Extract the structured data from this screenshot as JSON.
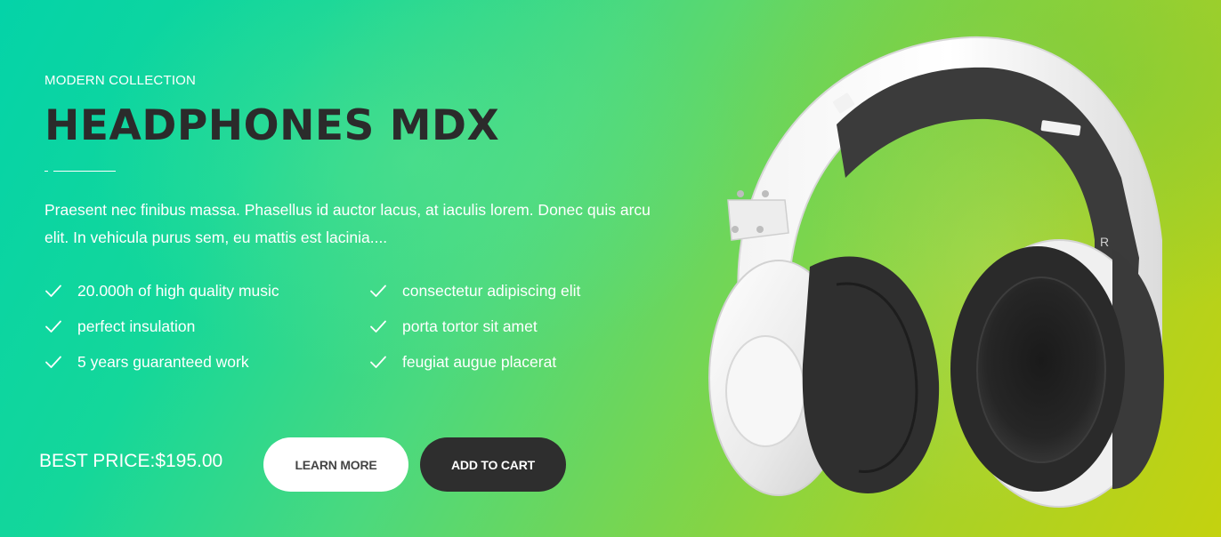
{
  "hero": {
    "eyebrow": "MODERN COLLECTION",
    "title": "HEADPHONES MDX",
    "description": "Praesent nec finibus massa. Phasellus id auctor lacus, at iaculis lorem. Donec quis arcu elit. In vehicula purus sem, eu mattis est lacinia....",
    "features": [
      "20.000h of high quality music",
      "perfect insulation",
      "5 years guaranteed work",
      "consectetur adipiscing elit",
      "porta tortor sit amet",
      "feugiat augue placerat"
    ],
    "price": "BEST PRICE:$195.00",
    "learn_more_label": "LEARN MORE",
    "add_to_cart_label": "ADD TO CART",
    "product_image_icon": "headphones-icon",
    "earcup_mark": "R"
  },
  "colors": {
    "gradient_start": "#04d3a8",
    "gradient_end": "#c4d20f",
    "title": "#2b2b2b",
    "cart_button": "#2e2e2e",
    "learn_button": "#ffffff"
  }
}
